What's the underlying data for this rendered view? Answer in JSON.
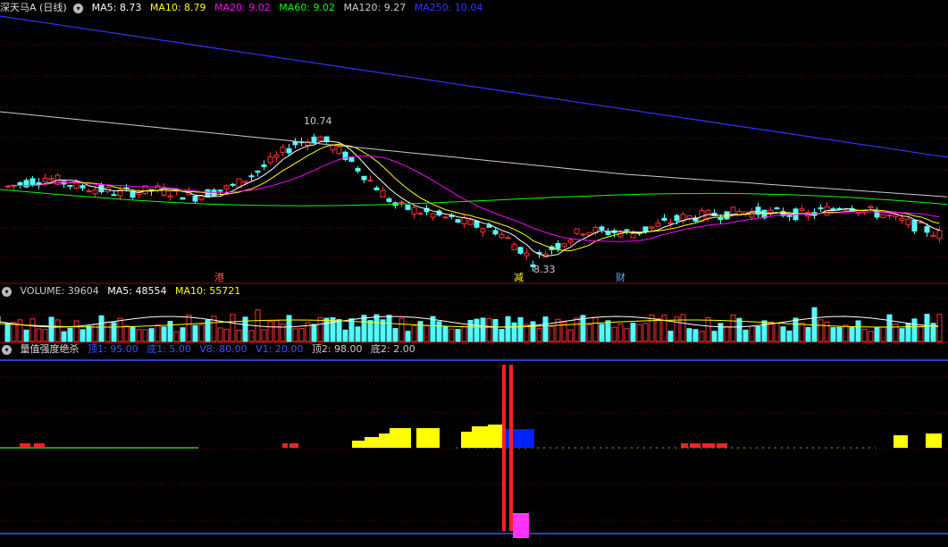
{
  "main": {
    "title": "深天马A (日线)",
    "ma": [
      {
        "label": "MA5: 8.73",
        "color": "#ffffff"
      },
      {
        "label": "MA10: 8.79",
        "color": "#ffff00"
      },
      {
        "label": "MA20: 9.02",
        "color": "#ff00ff"
      },
      {
        "label": "MA60: 9.02",
        "color": "#00ff00"
      },
      {
        "label": "MA120: 9.27",
        "color": "#cccccc"
      },
      {
        "label": "MA250: 10.04",
        "color": "#3333ff"
      }
    ],
    "high_label": "10.74",
    "low_label": "8.33",
    "markers": [
      "港",
      "减",
      "财"
    ]
  },
  "volume": {
    "labels": [
      {
        "label": "VOLUME: 39604",
        "color": "#cccccc"
      },
      {
        "label": "MA5: 48554",
        "color": "#ffffff"
      },
      {
        "label": "MA10: 55721",
        "color": "#ffff00"
      }
    ]
  },
  "indicator": {
    "title": "量值强度绝杀",
    "params": [
      {
        "label": "顶1: 95.00",
        "color": "#3355ff"
      },
      {
        "label": "底1: 5.00",
        "color": "#3355ff"
      },
      {
        "label": "V8: 80.00",
        "color": "#3355ff"
      },
      {
        "label": "V1: 20.00",
        "color": "#3355ff"
      },
      {
        "label": "顶2: 98.00",
        "color": "#cccccc"
      },
      {
        "label": "底2: 2.00",
        "color": "#cccccc"
      }
    ]
  },
  "chart_data": {
    "type": "candlestick",
    "price_range_visible": [
      8.33,
      10.74
    ],
    "annotated_high": 10.74,
    "annotated_low": 8.33,
    "last_close": 8.73,
    "moving_averages": {
      "MA5": 8.73,
      "MA10": 8.79,
      "MA20": 9.02,
      "MA60": 9.02,
      "MA120": 9.27,
      "MA250": 10.04
    },
    "volume": {
      "last": 39604,
      "MA5": 48554,
      "MA10": 55721
    },
    "indicator_params": {
      "顶1": 95,
      "底1": 5,
      "V8": 80,
      "V1": 20,
      "顶2": 98,
      "底2": 2
    },
    "colors": {
      "up": "#ff3232",
      "down": "#54ffff",
      "ma5": "#ffffff",
      "ma10": "#ffff00",
      "ma20": "#ff00ff",
      "ma60": "#00ff00",
      "ma120": "#cccccc",
      "ma250": "#3333ff"
    }
  }
}
